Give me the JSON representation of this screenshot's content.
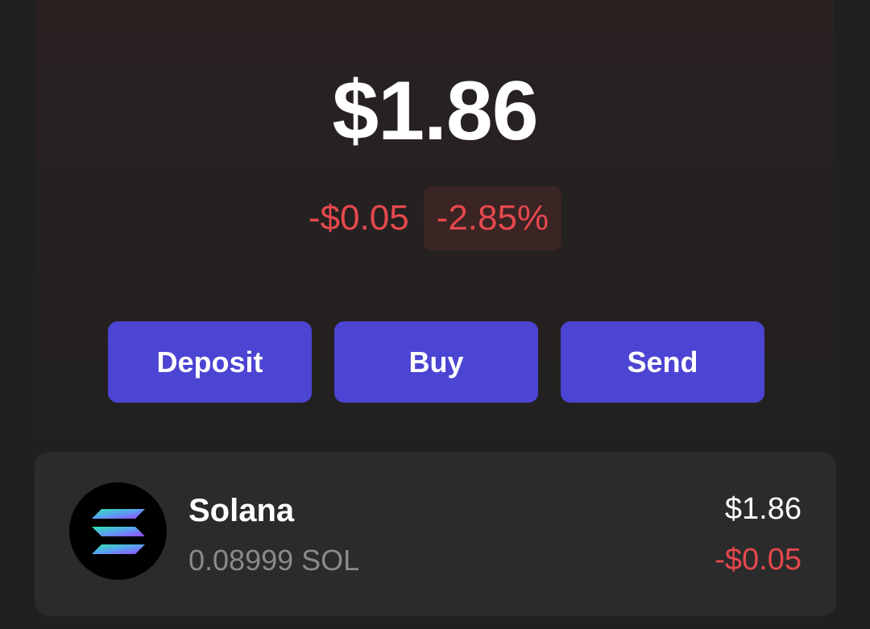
{
  "portfolio": {
    "balance": "$1.86",
    "change_amount": "-$0.05",
    "change_percent": "-2.85%"
  },
  "actions": {
    "deposit_label": "Deposit",
    "buy_label": "Buy",
    "send_label": "Send"
  },
  "tokens": [
    {
      "name": "Solana",
      "quantity": "0.08999 SOL",
      "value": "$1.86",
      "change": "-$0.05",
      "icon": "solana-logo-icon"
    }
  ],
  "colors": {
    "background": "#202020",
    "accent_button": "#4c44d2",
    "negative": "#e5484d",
    "negative_badge_bg": "#3a2424",
    "card": "#2b2b2b"
  }
}
